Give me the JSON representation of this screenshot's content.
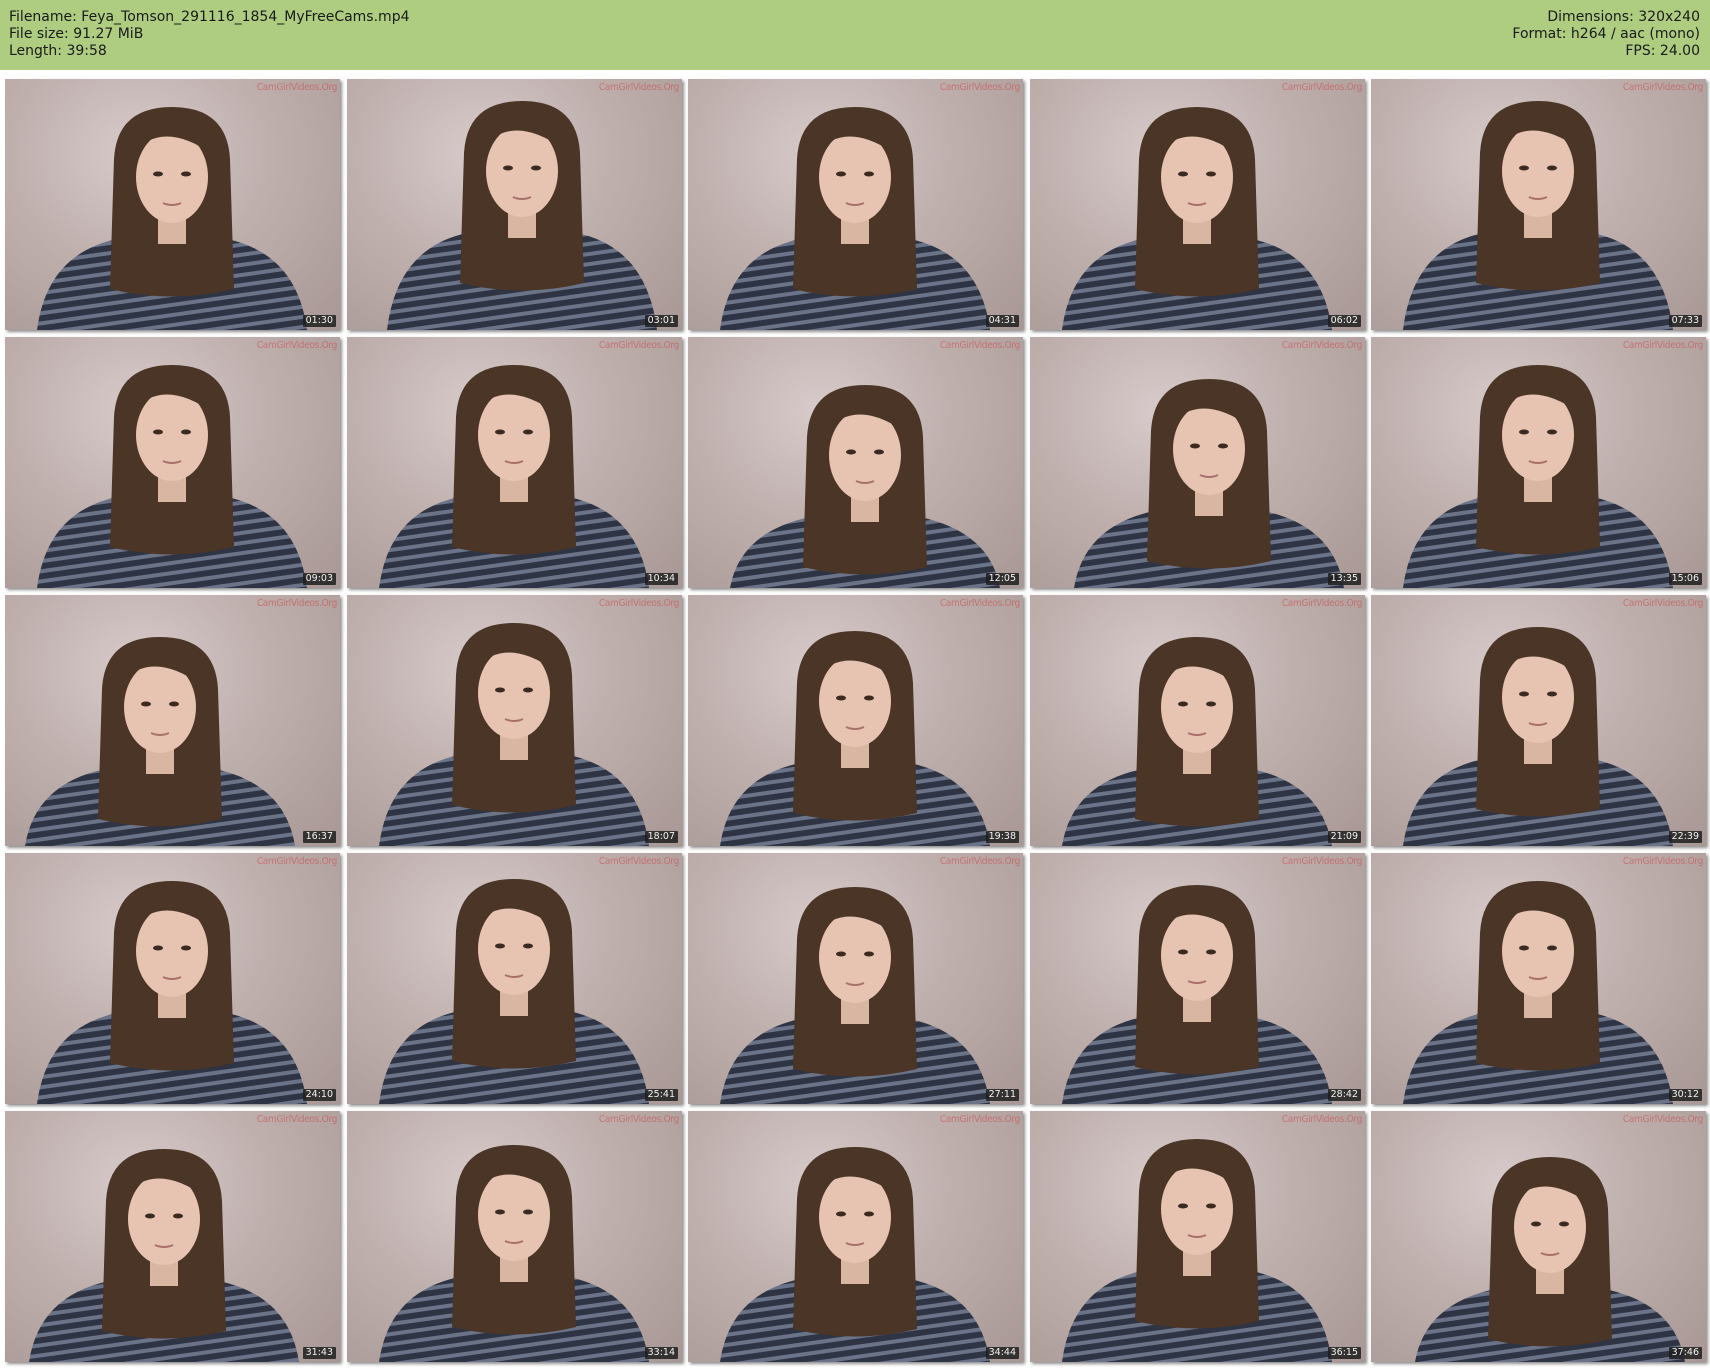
{
  "header": {
    "filename": "Filename: Feya_Tomson_291116_1854_MyFreeCams.mp4",
    "file_size": "File size: 91.27 MiB",
    "length": "Length: 39:58",
    "dimensions": "Dimensions: 320x240",
    "format": "Format: h264 / aac (mono)",
    "fps": "FPS: 24.00"
  },
  "colors": {
    "header_bg": "#aecd80",
    "background_wall": "#c2b3b1",
    "sweater": "#2e3444",
    "hair": "#4a3526"
  },
  "watermark_text": "CamGirlVideos.Org",
  "thumbnails": [
    {
      "timestamp": "01:30"
    },
    {
      "timestamp": "03:01"
    },
    {
      "timestamp": "04:31"
    },
    {
      "timestamp": "06:02"
    },
    {
      "timestamp": "07:33"
    },
    {
      "timestamp": "09:03"
    },
    {
      "timestamp": "10:34"
    },
    {
      "timestamp": "12:05"
    },
    {
      "timestamp": "13:35"
    },
    {
      "timestamp": "15:06"
    },
    {
      "timestamp": "16:37"
    },
    {
      "timestamp": "18:07"
    },
    {
      "timestamp": "19:38"
    },
    {
      "timestamp": "21:09"
    },
    {
      "timestamp": "22:39"
    },
    {
      "timestamp": "24:10"
    },
    {
      "timestamp": "25:41"
    },
    {
      "timestamp": "27:11"
    },
    {
      "timestamp": "28:42"
    },
    {
      "timestamp": "30:12"
    },
    {
      "timestamp": "31:43"
    },
    {
      "timestamp": "33:14"
    },
    {
      "timestamp": "34:44"
    },
    {
      "timestamp": "36:15"
    },
    {
      "timestamp": "37:46"
    }
  ]
}
